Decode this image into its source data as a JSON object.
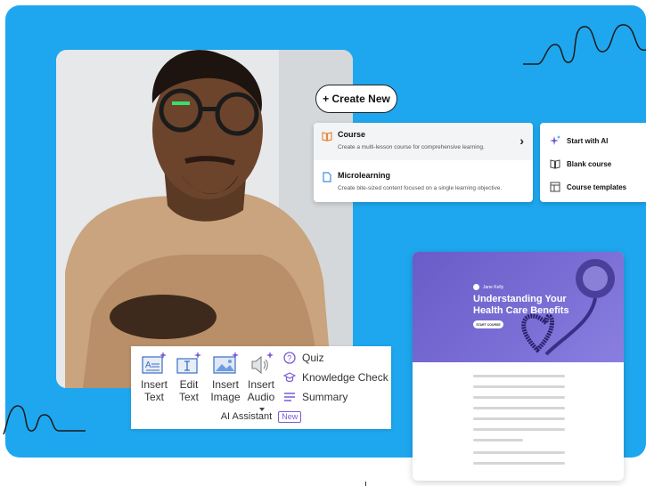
{
  "colors": {
    "background_blue": "#1ea7ee",
    "ai_purple": "#7b5ad6",
    "hero_purple": "#6a5cc8",
    "course_orange": "#e8883a",
    "micro_blue": "#3a8ee6"
  },
  "create_button": {
    "label": "+ Create New"
  },
  "create_menu": {
    "items": [
      {
        "icon": "book-icon",
        "title": "Course",
        "description": "Create a multi-lesson course for comprehensive learning."
      },
      {
        "icon": "document-icon",
        "title": "Microlearning",
        "description": "Create bite-sized content focused on a single learning objective."
      }
    ]
  },
  "course_submenu": {
    "items": [
      {
        "icon": "sparkle-icon",
        "label": "Start with AI"
      },
      {
        "icon": "book-outline-icon",
        "label": "Blank course"
      },
      {
        "icon": "template-icon",
        "label": "Course templates"
      }
    ]
  },
  "preview": {
    "author": "Jane Kelly",
    "title": "Understanding Your Health Care Benefits",
    "start_button": "START COURSE"
  },
  "ai_toolbar": {
    "tools": [
      {
        "icon": "insert-text-icon",
        "line1": "Insert",
        "line2": "Text"
      },
      {
        "icon": "edit-text-icon",
        "line1": "Edit",
        "line2": "Text"
      },
      {
        "icon": "insert-image-icon",
        "line1": "Insert",
        "line2": "Image"
      },
      {
        "icon": "insert-audio-icon",
        "line1": "Insert",
        "line2": "Audio"
      }
    ],
    "side_items": [
      {
        "icon": "quiz-icon",
        "label": "Quiz"
      },
      {
        "icon": "graduation-cap-icon",
        "label": "Knowledge Check"
      },
      {
        "icon": "summary-icon",
        "label": "Summary"
      }
    ],
    "footer_label": "AI Assistant",
    "new_badge": "New"
  }
}
